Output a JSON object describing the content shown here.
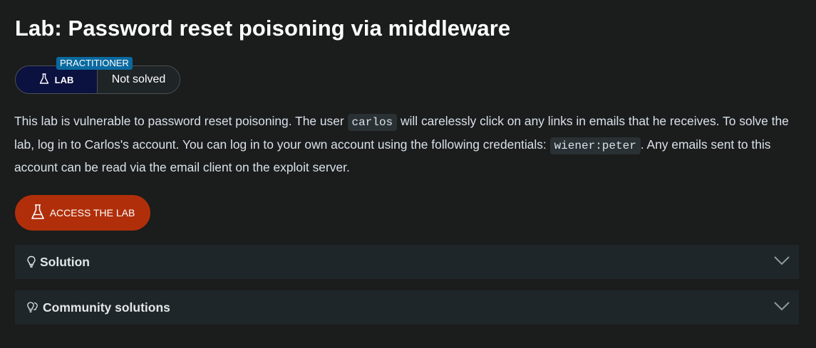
{
  "page": {
    "title": "Lab: Password reset poisoning via middleware"
  },
  "badge": {
    "level": "PRACTITIONER",
    "type_label": "LAB",
    "status": "Not solved"
  },
  "description": {
    "part1": "This lab is vulnerable to password reset poisoning. The user ",
    "code1": "carlos",
    "part2": " will carelessly click on any links in emails that he receives. To solve the lab, log in to Carlos's account. You can log in to your own account using the following credentials: ",
    "code2": "wiener:peter",
    "part3": ". Any emails sent to this account can be read via the email client on the exploit server."
  },
  "access_button": {
    "label": "ACCESS THE LAB"
  },
  "sections": {
    "solution": "Solution",
    "community": "Community solutions"
  },
  "colors": {
    "background": "#1b1c1c",
    "accent_orange": "#b02f0a",
    "practitioner_blue": "#0a6aa0",
    "lab_navy": "#0b1240"
  },
  "icons": {
    "lab": "flask-icon",
    "solution": "lightbulb-icon",
    "community": "lightbulbs-icon",
    "expand": "chevron-down-icon"
  }
}
